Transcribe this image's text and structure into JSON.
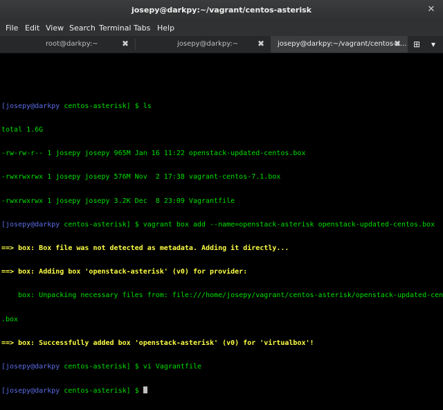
{
  "window": {
    "title": "josepy@darkpy:~/vagrant/centos-asterisk",
    "close_glyph": "✕"
  },
  "menu": [
    "File",
    "Edit",
    "View",
    "Search",
    "Terminal",
    "Tabs",
    "Help"
  ],
  "tabs": [
    {
      "label": "root@darkpy:~",
      "active": false
    },
    {
      "label": "josepy@darkpy:~",
      "active": false
    },
    {
      "label": "josepy@darkpy:~/vagrant/centos-a...",
      "active": true
    }
  ],
  "tab_close_glyph": "✖",
  "tab_add_glyph": "⊞",
  "tab_menu_glyph": "▾",
  "colors": {
    "user": "#5b6ee8",
    "green": "#00e000",
    "highlight": "#ffff44",
    "background": "#000000"
  },
  "terminal": {
    "lines": [
      {
        "type": "prompt",
        "user": "[josepy@darkpy",
        "path": " centos-asterisk]",
        "cmd": "$ ls"
      },
      {
        "type": "text",
        "text": "total 1.6G"
      },
      {
        "type": "text",
        "text": "-rw-rw-r-- 1 josepy josepy 965M Jan 16 11:22 openstack-updated-centos.box"
      },
      {
        "type": "text",
        "text": "-rwxrwxrwx 1 josepy josepy 576M Nov  2 17:38 vagrant-centos-7.1.box"
      },
      {
        "type": "text",
        "text": "-rwxrwxrwx 1 josepy josepy 3.2K Dec  8 23:09 Vagrantfile"
      },
      {
        "type": "prompt",
        "user": "[josepy@darkpy",
        "path": " centos-asterisk]",
        "cmd": "$ vagrant box add --name=openstack-asterisk openstack-updated-centos.box"
      },
      {
        "type": "hl",
        "text": "==> box: Box file was not detected as metadata. Adding it directly..."
      },
      {
        "type": "hl",
        "text": "==> box: Adding box 'openstack-asterisk' (v0) for provider:"
      },
      {
        "type": "text",
        "text": "    box: Unpacking necessary files from: file:///home/josepy/vagrant/centos-asterisk/openstack-updated-centos"
      },
      {
        "type": "text",
        "text": ".box"
      },
      {
        "type": "hl",
        "text": "==> box: Successfully added box 'openstack-asterisk' (v0) for 'virtualbox'!"
      },
      {
        "type": "prompt",
        "user": "[josepy@darkpy",
        "path": " centos-asterisk]",
        "cmd": "$ vi Vagrantfile"
      },
      {
        "type": "prompt",
        "user": "[josepy@darkpy",
        "path": " centos-asterisk]",
        "cmd": "$ ",
        "cursor": true
      }
    ]
  }
}
